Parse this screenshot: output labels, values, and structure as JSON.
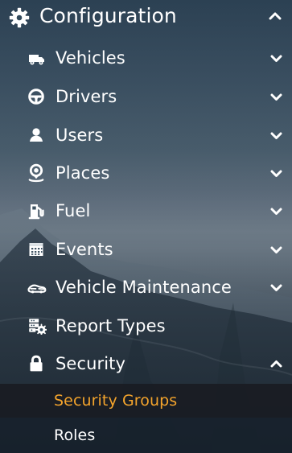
{
  "menu": {
    "configuration": {
      "label": "Configuration",
      "icon": "gear-icon"
    },
    "items": [
      {
        "label": "Vehicles",
        "icon": "truck-icon",
        "state": "collapsed"
      },
      {
        "label": "Drivers",
        "icon": "steering-wheel-icon",
        "state": "collapsed"
      },
      {
        "label": "Users",
        "icon": "user-icon",
        "state": "collapsed"
      },
      {
        "label": "Places",
        "icon": "map-pin-icon",
        "state": "collapsed"
      },
      {
        "label": "Fuel",
        "icon": "fuel-pump-icon",
        "state": "collapsed"
      },
      {
        "label": "Events",
        "icon": "calendar-icon",
        "state": "collapsed"
      },
      {
        "label": "Vehicle Maintenance",
        "icon": "car-wrench-icon",
        "state": "collapsed"
      },
      {
        "label": "Report Types",
        "icon": "report-types-icon",
        "state": "none"
      },
      {
        "label": "Security",
        "icon": "lock-icon",
        "state": "expanded"
      }
    ],
    "security_submenu": [
      {
        "label": "Security Groups",
        "active": true
      },
      {
        "label": "Roles",
        "active": false
      }
    ]
  },
  "colors": {
    "text": "#ffffff",
    "active_submenu_text": "#f4a42c",
    "active_submenu_background": "#1d2026"
  }
}
